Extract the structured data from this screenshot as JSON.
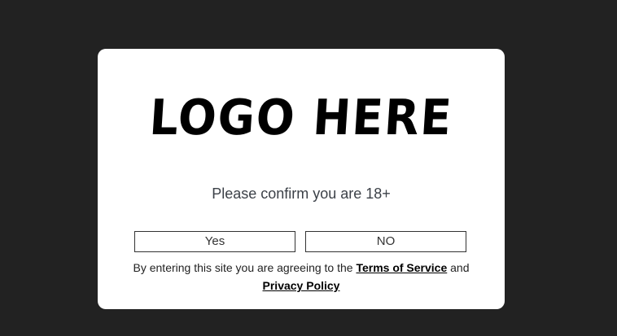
{
  "logo": {
    "text": "LOGO HERE"
  },
  "age_gate": {
    "prompt": "Please confirm you are 18+",
    "yes_label": "Yes",
    "no_label": "NO",
    "legal_prefix": "By entering this site you are agreeing to the",
    "terms_link": "Terms of Service",
    "legal_and": "and",
    "privacy_link": "Privacy Policy"
  },
  "colors": {
    "backdrop": "#222222",
    "modal": "#ffffff"
  }
}
